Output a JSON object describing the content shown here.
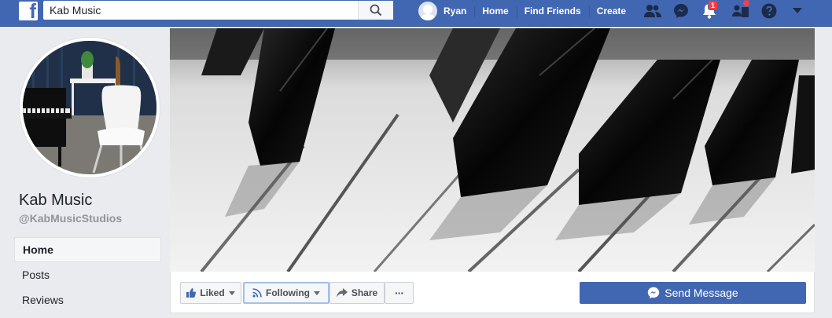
{
  "topbar": {
    "logo_letter": "f",
    "search": {
      "value": "Kab Music",
      "placeholder": "Search"
    },
    "user_name": "Ryan",
    "nav": [
      "Home",
      "Find Friends",
      "Create"
    ],
    "icons": [
      "friend-requests-icon",
      "messenger-icon",
      "notifications-icon",
      "pages-icon",
      "help-icon",
      "account-menu-icon"
    ],
    "notification_count": "1"
  },
  "page": {
    "name": "Kab Music",
    "handle": "@KabMusicStudios"
  },
  "side_nav": [
    {
      "label": "Home",
      "active": true
    },
    {
      "label": "Posts",
      "active": false
    },
    {
      "label": "Reviews",
      "active": false
    }
  ],
  "actions": {
    "liked": "Liked",
    "following": "Following",
    "share": "Share",
    "more": "···",
    "send_message": "Send Message"
  },
  "colors": {
    "brand": "#4267b2",
    "background": "#e9ebee",
    "badge": "#fa3e3e"
  }
}
